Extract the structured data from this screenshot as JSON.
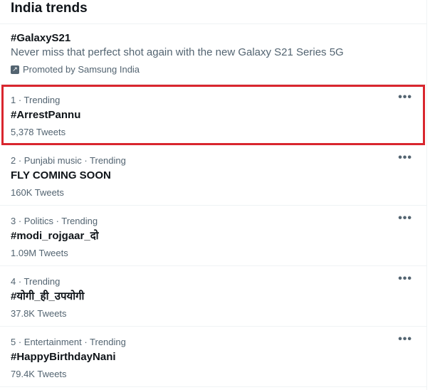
{
  "header": {
    "title": "India trends"
  },
  "promoted": {
    "title": "#GalaxyS21",
    "description": "Never miss that perfect shot again with the new Galaxy S21 Series 5G",
    "promoted_by": "Promoted by Samsung India",
    "icon": "promoted-arrow-icon"
  },
  "trends": [
    {
      "meta": "1 · Trending",
      "name": "#ArrestPannu",
      "count": "5,378 Tweets",
      "more": "•••"
    },
    {
      "meta": "2 · Punjabi music · Trending",
      "name": "FLY COMING SOON",
      "count": "160K Tweets",
      "more": "•••"
    },
    {
      "meta": "3 · Politics · Trending",
      "name": "#modi_rojgaar_दो",
      "count": "1.09M Tweets",
      "more": "•••"
    },
    {
      "meta": "4 · Trending",
      "name": "#योगी_ही_उपयोगी",
      "count": "37.8K Tweets",
      "more": "•••"
    },
    {
      "meta": "5 · Entertainment · Trending",
      "name": "#HappyBirthdayNani",
      "count": "79.4K Tweets",
      "more": "•••"
    }
  ],
  "colors": {
    "highlight_border": "#d9262e",
    "secondary_text": "#536471",
    "primary_text": "#0f1419"
  }
}
